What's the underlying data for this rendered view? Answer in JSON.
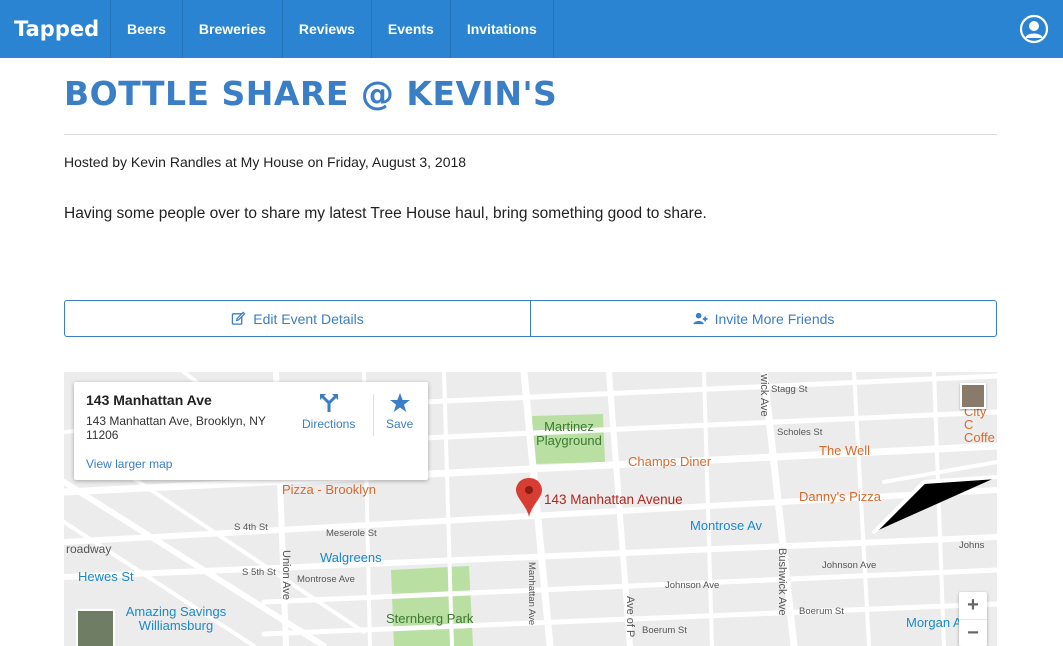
{
  "nav": {
    "brand": "Tapped",
    "items": [
      {
        "label": "Beers"
      },
      {
        "label": "Breweries"
      },
      {
        "label": "Reviews"
      },
      {
        "label": "Events"
      },
      {
        "label": "Invitations"
      }
    ],
    "user_icon": "user-circle-icon"
  },
  "event": {
    "title": "BOTTLE SHARE @ KEVIN'S",
    "hosted_line": "Hosted by Kevin Randles at My House on Friday, August 3, 2018",
    "description": "Having some people over to share my latest Tree House haul, bring something good to share."
  },
  "actions": {
    "edit_label": "Edit Event Details",
    "edit_icon": "edit-icon",
    "invite_label": "Invite More Friends",
    "invite_icon": "user-plus-icon"
  },
  "map": {
    "card": {
      "title": "143 Manhattan Ave",
      "address": "143 Manhattan Ave, Brooklyn, NY 11206",
      "larger_map": "View larger map",
      "directions": "Directions",
      "save": "Save"
    },
    "pin_label": "143 Manhattan Avenue",
    "places": {
      "martinez": "Martinez Playground",
      "champs": "Champs Diner",
      "the_well": "The Well",
      "dannys": "Danny's Pizza",
      "montrose": "Montrose Av",
      "walgreens": "Walgreens",
      "hewes": "Hewes St",
      "amazing": "Amazing Savings Williamsburg",
      "sternberg": "Sternberg Park",
      "pizza": "Pizza - Brooklyn",
      "morgan": "Morgan A",
      "city_coffee": "City C Coffe"
    },
    "streets": {
      "stagg": "Stagg St",
      "scholes": "Scholes St",
      "meserole": "Meserole St",
      "montrose_ave": "Montrose Ave",
      "johnson": "Johnson Ave",
      "boerum": "Boerum St",
      "s4th": "S 4th St",
      "s5th": "S 5th St",
      "union": "Union Ave",
      "manhattan": "Manhattan Ave",
      "bushwick": "Bushwick Ave",
      "broadway": "roadway",
      "graham": "Ave of P",
      "johnson2": "Johns",
      "wick": "wick Ave"
    },
    "zoom_in": "+",
    "zoom_out": "−",
    "colors": {
      "park": "#b9dfa3",
      "transit": "#1a9bd7",
      "food": "#e57b38",
      "pin": "#d73d32"
    }
  }
}
